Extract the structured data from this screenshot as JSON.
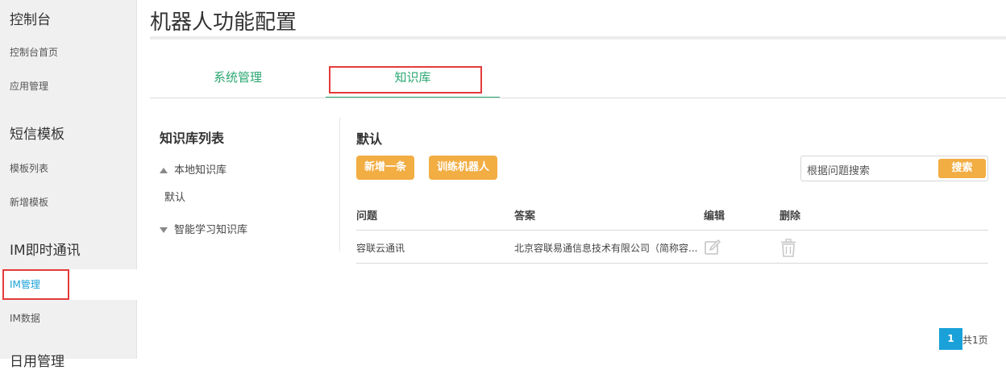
{
  "sidebar": {
    "sections": [
      {
        "title": "控制台",
        "items": [
          "控制台首页",
          "应用管理"
        ]
      },
      {
        "title": "短信模板",
        "items": [
          "模板列表",
          "新增模板"
        ]
      },
      {
        "title": "IM即时通讯",
        "items": [
          "IM管理",
          "IM数据"
        ]
      },
      {
        "title": "日用管理"
      }
    ],
    "active_item": "IM管理"
  },
  "page": {
    "title": "机器人功能配置"
  },
  "tabs": [
    {
      "label": "系统管理",
      "active": false
    },
    {
      "label": "知识库",
      "active": true
    }
  ],
  "kb_list": {
    "title": "知识库列表",
    "local": {
      "label": "本地知识库",
      "children": [
        "默认"
      ]
    },
    "smart": {
      "label": "智能学习知识库"
    }
  },
  "kb_detail": {
    "name": "默认",
    "buttons": {
      "add": "新增一条",
      "train": "训练机器人"
    },
    "search": {
      "placeholder": "根据问题搜索",
      "button": "搜索"
    },
    "table": {
      "headers": [
        "问题",
        "答案",
        "编辑",
        "删除"
      ],
      "rows": [
        {
          "question": "容联云通讯",
          "answer": "北京容联易通信息技术有限公司（简称容..."
        }
      ]
    }
  },
  "pagination": {
    "current": "1",
    "total": "共1页"
  },
  "colors": {
    "accent_green": "#2aa772",
    "orange": "#f2ad43",
    "blue": "#1aa1d9",
    "highlight_red": "#e43b3b"
  }
}
